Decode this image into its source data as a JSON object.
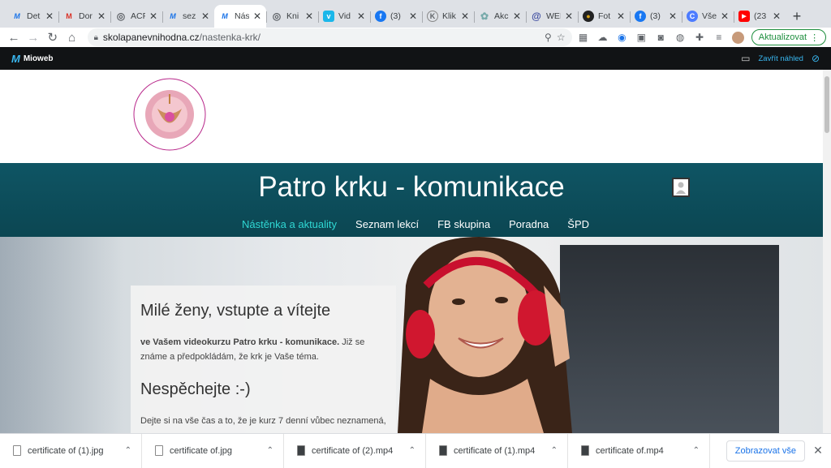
{
  "tabs": [
    {
      "title": "Det",
      "icon": "mioweb-icon",
      "color": "#1a73e8"
    },
    {
      "title": "Dor",
      "icon": "gmail-icon",
      "color": "#d93025"
    },
    {
      "title": "ACF",
      "icon": "globe-icon",
      "color": "#5f6368"
    },
    {
      "title": "sez",
      "icon": "mioweb-icon",
      "color": "#1a73e8"
    },
    {
      "title": "Nás",
      "icon": "mioweb-icon",
      "color": "#1a73e8",
      "active": true
    },
    {
      "title": "Kni",
      "icon": "globe-icon",
      "color": "#5f6368"
    },
    {
      "title": "Vid",
      "icon": "vimeo-icon",
      "color": "#1ab7ea"
    },
    {
      "title": "(3)",
      "icon": "facebook-icon",
      "color": "#1877f2"
    },
    {
      "title": "Klik",
      "icon": "link-icon",
      "color": "#5f6368"
    },
    {
      "title": "Akc",
      "icon": "globe-icon",
      "color": "#7aa"
    },
    {
      "title": "WEI",
      "icon": "web-icon",
      "color": "#3c4ba0"
    },
    {
      "title": "Fot",
      "icon": "photo-icon",
      "color": "#222"
    },
    {
      "title": "(3)",
      "icon": "facebook-icon",
      "color": "#1877f2"
    },
    {
      "title": "Vše",
      "icon": "circle-icon",
      "color": "#4d7cff"
    },
    {
      "title": "(23",
      "icon": "youtube-icon",
      "color": "#ff0000"
    }
  ],
  "toolbar": {
    "url_domain": "skolapanevnihodna.cz",
    "url_path": "/nastenka-krk/",
    "update_label": "Aktualizovat"
  },
  "mioweb": {
    "brand": "Mioweb",
    "close_preview": "Zavřít náhled"
  },
  "site": {
    "logo_text_top": "RENATY SAHANI 3X3 ŠKOLA PÁNEVNÍHO DNA",
    "title": "Patro krku - komunikace",
    "nav": [
      "Nástěnka a aktuality",
      "Seznam lekcí",
      "FB skupina",
      "Poradna",
      "ŠPD"
    ],
    "heading1": "Milé ženy, vstupte a vítejte",
    "para1_bold": "ve Vašem videokurzu Patro krku - komunikace.",
    "para1_rest": " Již se známe a předpokládám, že krk je Vaše téma.",
    "heading2": "Nespěchejte :-)",
    "para2": "Dejte si na vše čas a to, že je kurz 7 denní vůbec neznamená,"
  },
  "downloads": {
    "items": [
      "certificate of (1).jpg",
      "certificate of.jpg",
      "certificate of (2).mp4",
      "certificate of (1).mp4",
      "certificate of.mp4"
    ],
    "show_all": "Zobrazovat vše"
  },
  "colors": {
    "accent": "#2fd7d3",
    "hero_bg": "#0f5564"
  }
}
